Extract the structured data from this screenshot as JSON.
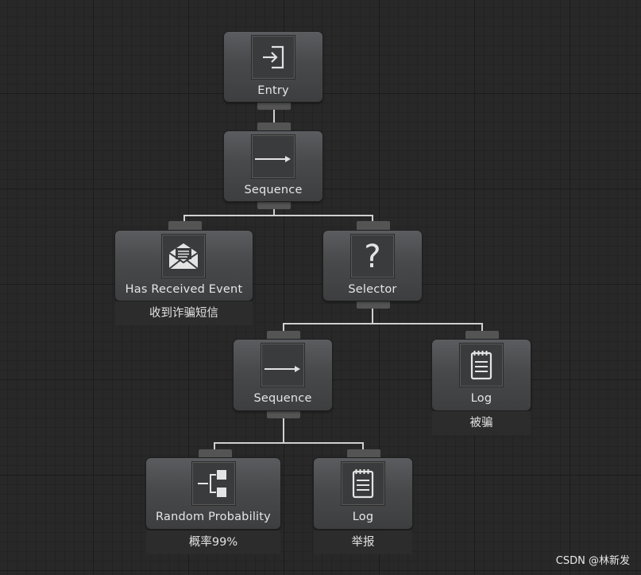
{
  "nodes": {
    "entry": {
      "label": "Entry",
      "icon": "entry-icon"
    },
    "sequence_root": {
      "label": "Sequence",
      "icon": "arrow-right-icon"
    },
    "has_received_event": {
      "label": "Has Received Event",
      "icon": "envelope-icon",
      "comment": "收到诈骗短信"
    },
    "selector": {
      "label": "Selector",
      "icon": "question-mark-icon"
    },
    "sequence_child": {
      "label": "Sequence",
      "icon": "arrow-right-icon"
    },
    "log_scammed": {
      "label": "Log",
      "icon": "notepad-icon",
      "comment": "被骗"
    },
    "random_probability": {
      "label": "Random Probability",
      "icon": "random-branch-icon",
      "comment": "概率99%"
    },
    "log_report": {
      "label": "Log",
      "icon": "notepad-icon",
      "comment": "举报"
    }
  },
  "watermark": "CSDN @林新发"
}
